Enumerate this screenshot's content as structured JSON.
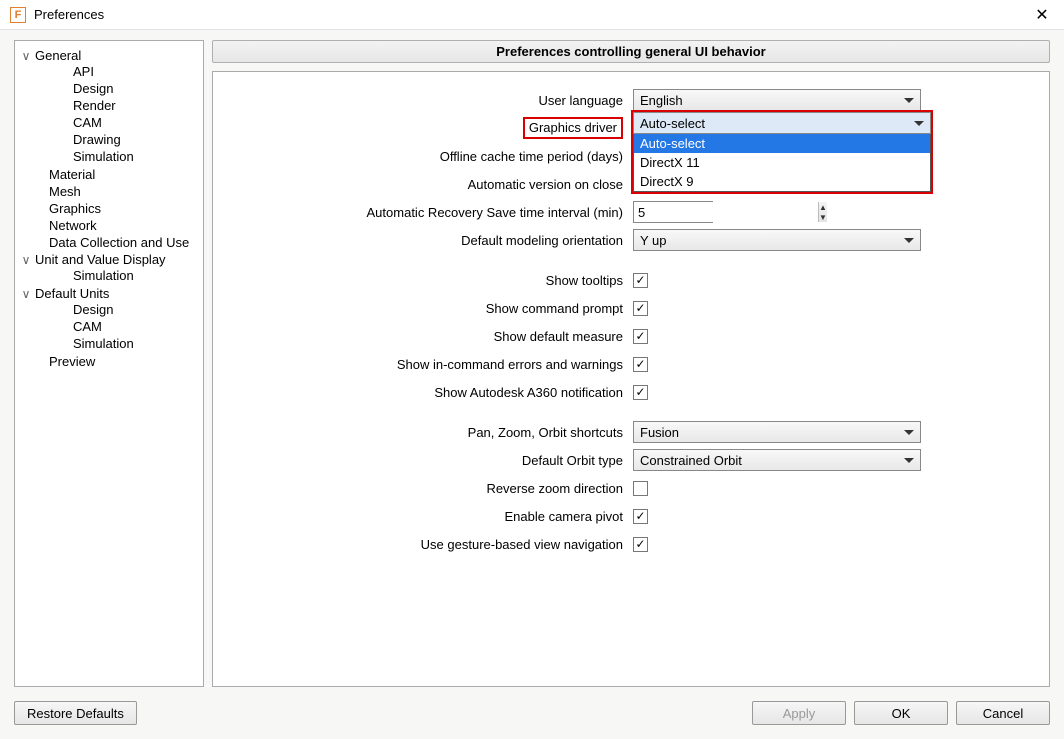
{
  "window": {
    "title": "Preferences",
    "close_glyph": "✕"
  },
  "tree": {
    "general": {
      "label": "General",
      "expanded": true,
      "children": {
        "api": "API",
        "design": "Design",
        "render": "Render",
        "cam": "CAM",
        "drawing": "Drawing",
        "simulation": "Simulation"
      }
    },
    "material": "Material",
    "mesh": "Mesh",
    "graphics": "Graphics",
    "network": "Network",
    "data_collection": "Data Collection and Use",
    "unit_display": {
      "label": "Unit and Value Display",
      "expanded": true,
      "children": {
        "simulation": "Simulation"
      }
    },
    "default_units": {
      "label": "Default Units",
      "expanded": true,
      "children": {
        "design": "Design",
        "cam": "CAM",
        "simulation": "Simulation"
      }
    },
    "preview": "Preview"
  },
  "section_header": "Preferences controlling general UI behavior",
  "form": {
    "user_language": {
      "label": "User language",
      "value": "English"
    },
    "graphics_driver": {
      "label": "Graphics driver",
      "value": "Auto-select",
      "options": [
        "Auto-select",
        "DirectX 11",
        "DirectX 9"
      ]
    },
    "offline_cache": {
      "label": "Offline cache time period (days)"
    },
    "auto_version_close": {
      "label": "Automatic version on close"
    },
    "recovery_interval": {
      "label": "Automatic Recovery Save time interval (min)",
      "value": "5"
    },
    "default_orientation": {
      "label": "Default modeling orientation",
      "value": "Y up"
    },
    "show_tooltips": {
      "label": "Show tooltips",
      "checked": true
    },
    "show_command_prompt": {
      "label": "Show command prompt",
      "checked": true
    },
    "show_default_measure": {
      "label": "Show default measure",
      "checked": true
    },
    "show_in_command_errors": {
      "label": "Show in-command errors and warnings",
      "checked": true
    },
    "show_a360_notification": {
      "label": "Show Autodesk A360 notification",
      "checked": true
    },
    "pan_zoom_orbit": {
      "label": "Pan, Zoom, Orbit shortcuts",
      "value": "Fusion"
    },
    "default_orbit_type": {
      "label": "Default Orbit type",
      "value": "Constrained Orbit"
    },
    "reverse_zoom": {
      "label": "Reverse zoom direction",
      "checked": false
    },
    "enable_camera_pivot": {
      "label": "Enable camera pivot",
      "checked": true
    },
    "gesture_nav": {
      "label": "Use gesture-based view navigation",
      "checked": true
    }
  },
  "buttons": {
    "restore_defaults": "Restore Defaults",
    "apply": "Apply",
    "ok": "OK",
    "cancel": "Cancel"
  }
}
